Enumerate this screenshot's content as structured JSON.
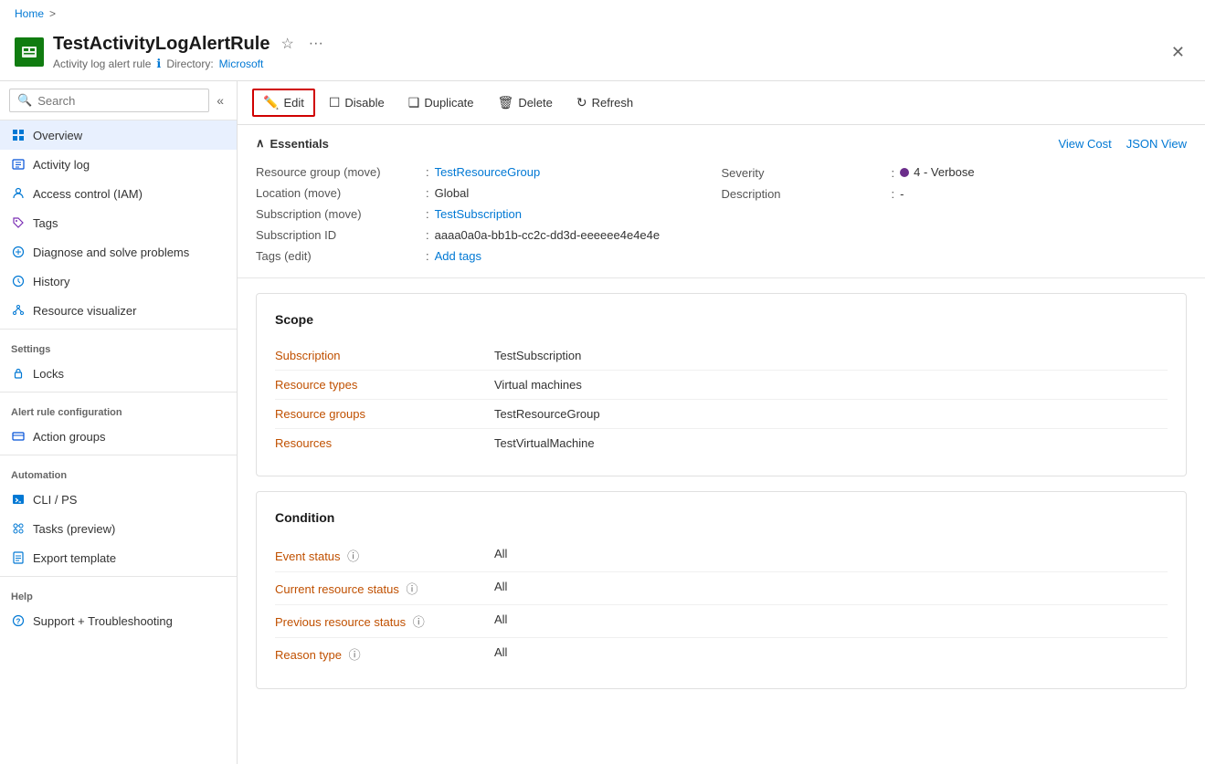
{
  "breadcrumb": {
    "home": "Home",
    "sep": ">"
  },
  "resource": {
    "title": "TestActivityLogAlertRule",
    "subtitle_type": "Activity log alert rule",
    "subtitle_dir_label": "Directory:",
    "subtitle_dir_value": "Microsoft"
  },
  "toolbar": {
    "edit": "Edit",
    "disable": "Disable",
    "duplicate": "Duplicate",
    "delete": "Delete",
    "refresh": "Refresh"
  },
  "essentials": {
    "section_title": "Essentials",
    "view_cost": "View Cost",
    "json_view": "JSON View",
    "resource_group_label": "Resource group",
    "resource_group_move": "move",
    "resource_group_value": "TestResourceGroup",
    "location_label": "Location",
    "location_move": "move",
    "location_value": "Global",
    "subscription_label": "Subscription",
    "subscription_move": "move",
    "subscription_value": "TestSubscription",
    "subscription_id_label": "Subscription ID",
    "subscription_id_value": "aaaa0a0a-bb1b-cc2c-dd3d-eeeeee4e4e4e",
    "tags_label": "Tags",
    "tags_edit": "edit",
    "tags_value": "Add tags",
    "severity_label": "Severity",
    "severity_value": "4 - Verbose",
    "description_label": "Description",
    "description_value": "-"
  },
  "scope": {
    "title": "Scope",
    "subscription_label": "Subscription",
    "subscription_value": "TestSubscription",
    "resource_types_label": "Resource types",
    "resource_types_value": "Virtual machines",
    "resource_groups_label": "Resource groups",
    "resource_groups_value": "TestResourceGroup",
    "resources_label": "Resources",
    "resources_value": "TestVirtualMachine"
  },
  "condition": {
    "title": "Condition",
    "event_status_label": "Event status",
    "event_status_value": "All",
    "current_resource_status_label": "Current resource status",
    "current_resource_status_value": "All",
    "previous_resource_status_label": "Previous resource status",
    "previous_resource_status_value": "All",
    "reason_type_label": "Reason type",
    "reason_type_value": "All"
  },
  "sidebar": {
    "search_placeholder": "Search",
    "items": [
      {
        "id": "overview",
        "label": "Overview",
        "active": true
      },
      {
        "id": "activity-log",
        "label": "Activity log",
        "active": false
      },
      {
        "id": "iam",
        "label": "Access control (IAM)",
        "active": false
      },
      {
        "id": "tags",
        "label": "Tags",
        "active": false
      },
      {
        "id": "diagnose",
        "label": "Diagnose and solve problems",
        "active": false
      },
      {
        "id": "history",
        "label": "History",
        "active": false
      },
      {
        "id": "resource-visualizer",
        "label": "Resource visualizer",
        "active": false
      }
    ],
    "sections": [
      {
        "label": "Settings",
        "items": [
          {
            "id": "locks",
            "label": "Locks"
          }
        ]
      },
      {
        "label": "Alert rule configuration",
        "items": [
          {
            "id": "action-groups",
            "label": "Action groups"
          }
        ]
      },
      {
        "label": "Automation",
        "items": [
          {
            "id": "cli-ps",
            "label": "CLI / PS"
          },
          {
            "id": "tasks",
            "label": "Tasks (preview)"
          },
          {
            "id": "export-template",
            "label": "Export template"
          }
        ]
      },
      {
        "label": "Help",
        "items": [
          {
            "id": "support",
            "label": "Support + Troubleshooting"
          }
        ]
      }
    ]
  }
}
